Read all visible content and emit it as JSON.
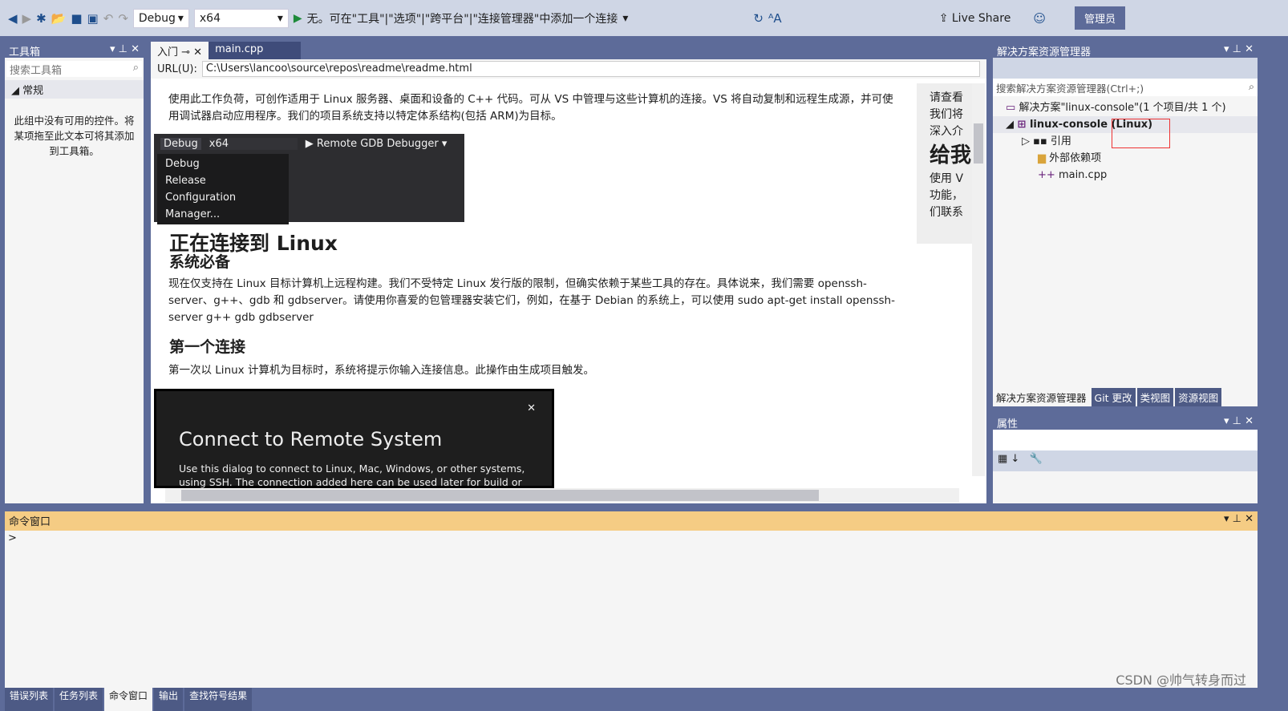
{
  "toolbar": {
    "config": "Debug",
    "platform": "x64",
    "run_text": "无。可在\"工具\"|\"选项\"|\"跨平台\"|\"连接管理器\"中添加一个连接",
    "live_share": "Live Share",
    "admin": "管理员"
  },
  "toolbox": {
    "title": "工具箱",
    "search_placeholder": "搜索工具箱",
    "group": "常规",
    "empty_text": "此组中没有可用的控件。将某项拖至此文本可将其添加到工具箱。"
  },
  "editor": {
    "tabs": [
      {
        "label": "入门"
      },
      {
        "label": "main.cpp"
      }
    ],
    "url_label": "URL(U):",
    "url": "C:\\Users\\lancoo\\source\\repos\\readme\\readme.html",
    "intro": "使用此工作负荷，可创作适用于 Linux 服务器、桌面和设备的 C++ 代码。可从 VS 中管理与这些计算机的连接。VS 将自动复制和远程生成源，并可使用调试器启动应用程序。我们的项目系统支持以特定体系结构(包括 ARM)为目标。",
    "shot": {
      "config": "Debug",
      "platform": "x64",
      "debugger": "Remote GDB Debugger",
      "menu": [
        "Debug",
        "Release",
        "Configuration Manager..."
      ]
    },
    "h1": "正在连接到 Linux",
    "h2a": "系统必备",
    "p2": "现在仅支持在 Linux 目标计算机上远程构建。我们不受特定 Linux 发行版的限制，但确实依赖于某些工具的存在。具体说来，我们需要 openssh-server、g++、gdb 和 gdbserver。请使用你喜爱的包管理器安装它们，例如，在基于 Debian 的系统上，可以使用 sudo apt-get install openssh-server g++ gdb gdbserver",
    "h2b": "第一个连接",
    "p3": "第一次以 Linux 计算机为目标时，系统将提示你输入连接信息。此操作由生成项目触发。",
    "dialog": {
      "title": "Connect to Remote System",
      "text": "Use this dialog to connect to Linux, Mac, Windows, or other systems, using SSH. The connection added here can be used later for build or debugging,"
    },
    "side": [
      "请查看",
      "我们将",
      "深入介",
      "给我",
      "使用 V",
      "功能，",
      "们联系"
    ]
  },
  "solution": {
    "title": "解决方案资源管理器",
    "search_placeholder": "搜索解决方案资源管理器(Ctrl+;)",
    "root": "解决方案\"linux-console\"(1 个项目/共 1 个)",
    "project": "linux-console (Linux)",
    "items": [
      "引用",
      "外部依赖项",
      "main.cpp"
    ],
    "tabs": [
      "解决方案资源管理器",
      "Git 更改",
      "类视图",
      "资源视图"
    ]
  },
  "properties": {
    "title": "属性"
  },
  "command": {
    "title": "命令窗口",
    "prompt": ">"
  },
  "bottom_tabs": [
    "错误列表",
    "任务列表",
    "命令窗口",
    "输出",
    "查找符号结果"
  ],
  "watermark": "CSDN @帅气转身而过"
}
